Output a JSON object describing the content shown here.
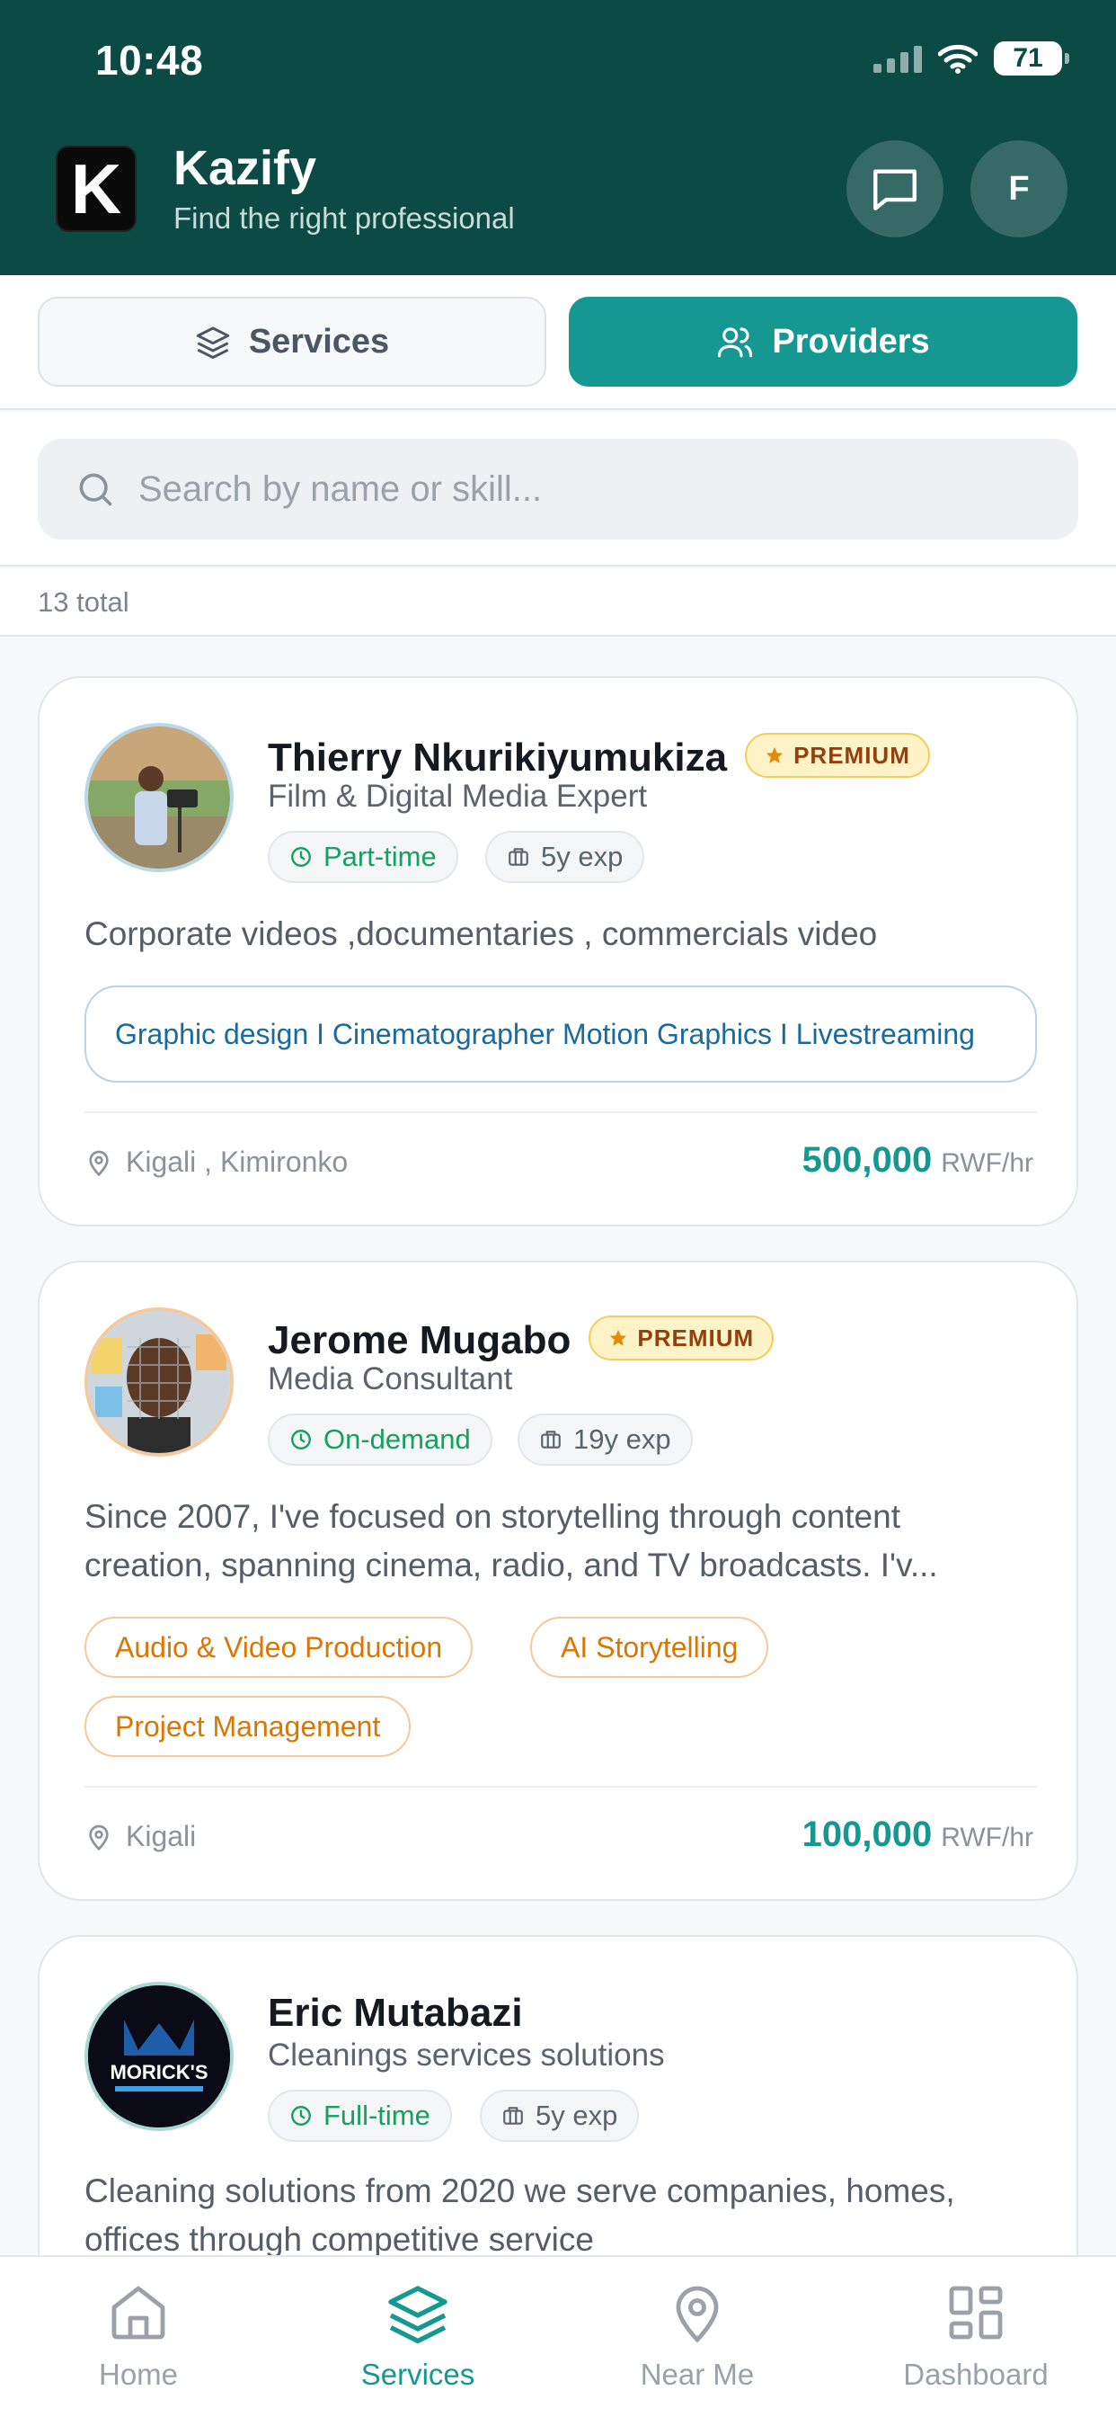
{
  "status": {
    "time": "10:48",
    "battery": "71"
  },
  "header": {
    "app_name": "Kazify",
    "logo_letter": "K",
    "subtitle": "Find the right professional",
    "avatar_initial": "F"
  },
  "tabs": [
    {
      "label": "Services",
      "active": false
    },
    {
      "label": "Providers",
      "active": true
    }
  ],
  "search": {
    "placeholder": "Search by name or skill..."
  },
  "total": "13 total",
  "colors": {
    "header": "#0c4a45",
    "accent": "#149891",
    "premium_bg": "#fef3c7",
    "available": "#16a05f"
  },
  "providers": [
    {
      "name": "Thierry Nkurikiyumukiza",
      "badge": "PREMIUM",
      "role": "Film & Digital Media Expert",
      "availability": "Part-time",
      "experience": "5y exp",
      "description": "Corporate videos ,documentaries , commercials video",
      "skills": [
        "Graphic design I Cinematographer Motion Graphics I Livestreaming"
      ],
      "location": "Kigali , Kimironko",
      "price": "500,000",
      "unit": "RWF/hr"
    },
    {
      "name": "Jerome Mugabo",
      "badge": "PREMIUM",
      "role": "Media Consultant",
      "availability": "On-demand",
      "experience": "19y exp",
      "description": "Since 2007, I've focused on storytelling through content creation, spanning cinema, radio, and TV broadcasts. I'v...",
      "skills": [
        "Audio & Video Production",
        "AI Storytelling",
        "Project Management"
      ],
      "location": "Kigali",
      "price": "100,000",
      "unit": "RWF/hr"
    },
    {
      "name": "Eric Mutabazi",
      "role": "Cleanings services solutions",
      "availability": "Full-time",
      "experience": "5y exp",
      "description": "Cleaning solutions from 2020 we serve companies, homes, offices through competitive service",
      "avatar_text": "MORICK'S"
    }
  ],
  "nav": [
    {
      "label": "Home",
      "icon": "home-icon"
    },
    {
      "label": "Services",
      "icon": "layers-icon"
    },
    {
      "label": "Near Me",
      "icon": "map-pin-icon"
    },
    {
      "label": "Dashboard",
      "icon": "grid-icon"
    }
  ]
}
